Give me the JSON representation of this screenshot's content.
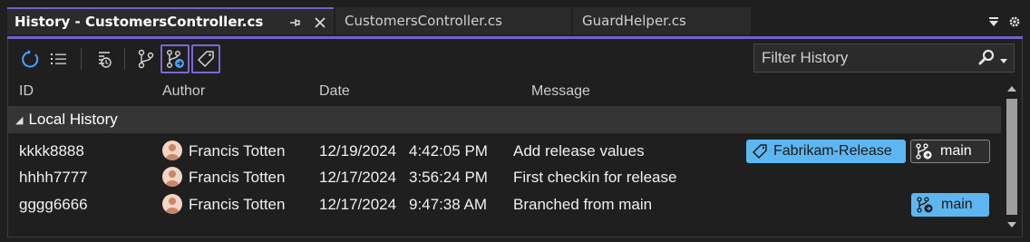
{
  "tabs": [
    {
      "title": "History - CustomersController.cs",
      "active": true
    },
    {
      "title": "CustomersController.cs",
      "active": false
    },
    {
      "title": "GuardHelper.cs",
      "active": false
    }
  ],
  "icons": {
    "pin": "pin-icon",
    "close": "close-icon",
    "dropdown": "tab-dropdown-icon",
    "settings": "gear-icon",
    "refresh": "refresh-icon",
    "list": "list-view-icon",
    "history": "history-icon",
    "branch": "branch-icon",
    "branch_remote": "remote-branch-icon",
    "tag": "tag-icon",
    "search": "search-icon",
    "chevron": "chevron-down-icon"
  },
  "filter": {
    "placeholder": "Filter History"
  },
  "columns": [
    "ID",
    "Author",
    "Date",
    "Message"
  ],
  "group": {
    "label": "Local History",
    "expanded": true
  },
  "commits": [
    {
      "id": "kkkk8888",
      "author": "Francis Totten",
      "date": "12/19/2024",
      "time": "4:42:05 PM",
      "message": "Add release values",
      "refs": [
        {
          "label": "Fabrikam-Release",
          "kind": "tag",
          "style": "blue"
        },
        {
          "label": "main",
          "kind": "remote-branch",
          "style": "gray"
        }
      ]
    },
    {
      "id": "hhhh7777",
      "author": "Francis Totten",
      "date": "12/17/2024",
      "time": "3:56:24 PM",
      "message": "First checkin for release",
      "refs": []
    },
    {
      "id": "gggg6666",
      "author": "Francis Totten",
      "date": "12/17/2024",
      "time": "9:47:38 AM",
      "message": "Branched from main",
      "refs": [
        {
          "label": "main",
          "kind": "branch",
          "style": "blue"
        }
      ]
    }
  ],
  "colors": {
    "accent": "#7560c9",
    "tag_blue": "#5eb6f0",
    "refresh": "#4aa3ff"
  }
}
